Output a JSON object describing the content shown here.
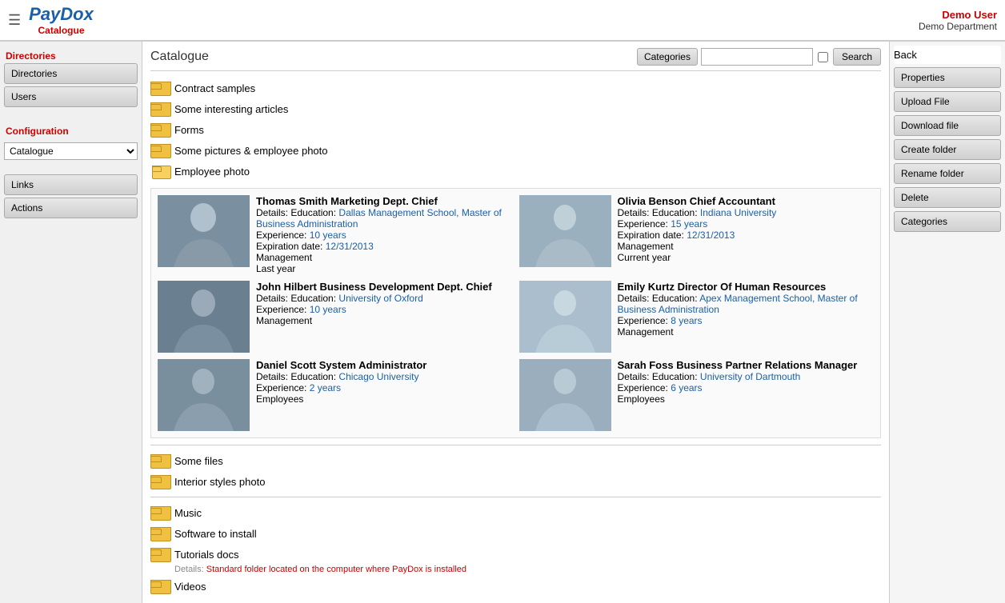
{
  "header": {
    "hamburger": "≡",
    "logo": "PayDox",
    "subtitle": "Catalogue",
    "user": "Demo User",
    "department": "Demo Department"
  },
  "left_sidebar": {
    "directories_label": "Directories",
    "directories_btn": "Directories",
    "users_btn": "Users",
    "configuration_label": "Configuration",
    "config_options": [
      "Catalogue"
    ],
    "config_selected": "Catalogue",
    "links_btn": "Links",
    "actions_btn": "Actions"
  },
  "right_sidebar": {
    "back_btn": "Back",
    "properties_btn": "Properties",
    "upload_btn": "Upload File",
    "download_btn": "Download file",
    "create_folder_btn": "Create folder",
    "rename_folder_btn": "Rename folder",
    "delete_btn": "Delete",
    "categories_btn": "Categories"
  },
  "main": {
    "title": "Catalogue",
    "categories_btn": "Categories",
    "search_placeholder": "",
    "search_btn": "Search",
    "folders": [
      {
        "name": "Contract samples",
        "open": false
      },
      {
        "name": "Some interesting articles",
        "open": false
      },
      {
        "name": "Forms",
        "open": false
      },
      {
        "name": "Some pictures & employee photo",
        "open": false
      },
      {
        "name": "Employee photo",
        "open": true
      }
    ],
    "employees": [
      {
        "name": "Thomas Smith Marketing Dept. Chief",
        "details_label": "Details:",
        "education_label": "Education:",
        "education": "Dallas Management School, Master of Business Administration",
        "experience_label": "Experience:",
        "experience": "10 years",
        "expiration_label": "Expiration date:",
        "expiration": "12/31/2013",
        "tag1": "Management",
        "tag2": "Last year",
        "photo_class": "photo-thomas"
      },
      {
        "name": "Olivia Benson Chief Accountant",
        "details_label": "Details:",
        "education_label": "Education:",
        "education": "Indiana University",
        "experience_label": "Experience:",
        "experience": "15 years",
        "expiration_label": "Expiration date:",
        "expiration": "12/31/2013",
        "tag1": "Management",
        "tag2": "Current year",
        "photo_class": "photo-olivia"
      },
      {
        "name": "John Hilbert Business Development Dept. Chief",
        "details_label": "Details:",
        "education_label": "Education:",
        "education": "University of Oxford",
        "experience_label": "Experience:",
        "experience": "10 years",
        "expiration_label": "",
        "expiration": "",
        "tag1": "Management",
        "tag2": "",
        "photo_class": "photo-john"
      },
      {
        "name": "Emily Kurtz Director Of Human Resources",
        "details_label": "Details:",
        "education_label": "Education:",
        "education": "Apex Management School, Master of Business Administration",
        "experience_label": "Experience:",
        "experience": "8 years",
        "expiration_label": "",
        "expiration": "",
        "tag1": "Management",
        "tag2": "",
        "photo_class": "photo-emily"
      },
      {
        "name": "Daniel Scott System Administrator",
        "details_label": "Details:",
        "education_label": "Education:",
        "education": "Chicago University",
        "experience_label": "Experience:",
        "experience": "2 years",
        "expiration_label": "",
        "expiration": "",
        "tag1": "Employees",
        "tag2": "",
        "photo_class": "photo-daniel"
      },
      {
        "name": "Sarah Foss Business Partner Relations Manager",
        "details_label": "Details:",
        "education_label": "Education:",
        "education": "University of Dartmouth",
        "experience_label": "Experience:",
        "experience": "6 years",
        "expiration_label": "",
        "expiration": "",
        "tag1": "Employees",
        "tag2": "",
        "photo_class": "photo-sarah"
      }
    ],
    "bottom_folders": [
      {
        "name": "Some files",
        "open": false,
        "detail": ""
      },
      {
        "name": "Interior styles photo",
        "open": false,
        "detail": ""
      }
    ],
    "bottom_folders2": [
      {
        "name": "Music",
        "open": false,
        "detail": ""
      },
      {
        "name": "Software to install",
        "open": false,
        "detail": ""
      },
      {
        "name": "Tutorials docs",
        "open": false,
        "detail": "Standard folder located on the computer where PayDox is installed"
      },
      {
        "name": "Videos",
        "open": false,
        "detail": ""
      }
    ]
  }
}
